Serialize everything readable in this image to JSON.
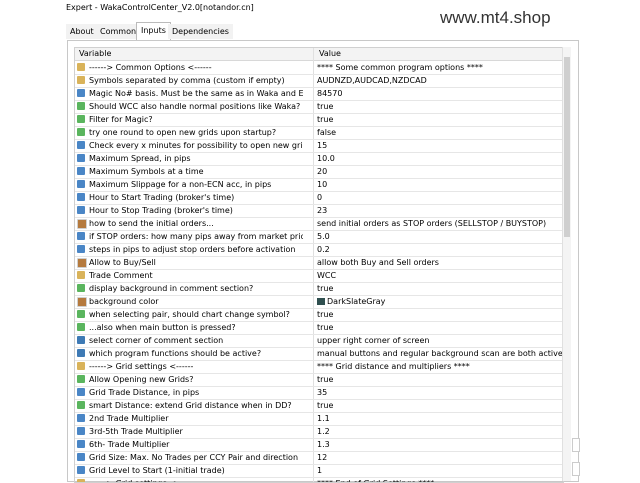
{
  "window": {
    "title": "Expert - WakaControlCenter_V2.0[notandor.cn]"
  },
  "watermark": "www.mt4.shop",
  "tabs": [
    {
      "label": "About"
    },
    {
      "label": "Common"
    },
    {
      "label": "Inputs"
    },
    {
      "label": "Dependencies"
    }
  ],
  "columns": {
    "variable": "Variable",
    "value": "Value"
  },
  "rows": [
    {
      "icon": "ab",
      "name": "------> Common Options <------",
      "value": "****      Some common program options         ****"
    },
    {
      "icon": "ab",
      "name": "Symbols separated by comma (custom if empty)",
      "value": "AUDNZD,AUDCAD,NZDCAD"
    },
    {
      "icon": "num",
      "name": "Magic No# basis. Must be the same as in Waka and End on...",
      "value": "84570"
    },
    {
      "icon": "line",
      "name": "Should WCC also handle normal positions like Waka?",
      "value": "true"
    },
    {
      "icon": "line",
      "name": "Filter for Magic?",
      "value": "true"
    },
    {
      "icon": "line",
      "name": "try one round to open new grids upon startup?",
      "value": "false"
    },
    {
      "icon": "num",
      "name": "Check every x minutes for possibility to open new grids",
      "value": "15"
    },
    {
      "icon": "num",
      "name": "Maximum Spread, in pips",
      "value": "10.0"
    },
    {
      "icon": "num",
      "name": "Maximum Symbols at a time",
      "value": "20"
    },
    {
      "icon": "num",
      "name": "Maximum Slippage for a non-ECN acc, in pips",
      "value": "10"
    },
    {
      "icon": "num",
      "name": "Hour to Start Trading (broker's time)",
      "value": "0"
    },
    {
      "icon": "num",
      "name": "Hour to Stop Trading (broker's time)",
      "value": "23"
    },
    {
      "icon": "grid",
      "name": "how to send the initial orders...",
      "value": "send initial orders as STOP orders (SELLSTOP / BUYSTOP)"
    },
    {
      "icon": "num",
      "name": "if STOP orders: how many pips away from market price?",
      "value": "5.0"
    },
    {
      "icon": "num",
      "name": "steps in pips to adjust stop orders before activation",
      "value": "0.2"
    },
    {
      "icon": "grid",
      "name": "Allow to Buy/Sell",
      "value": "allow both Buy and Sell orders"
    },
    {
      "icon": "ab",
      "name": "Trade Comment",
      "value": "WCC"
    },
    {
      "icon": "line",
      "name": "display background in comment section?",
      "value": "true"
    },
    {
      "icon": "grid",
      "name": "background color",
      "value": "DarkSlateGray",
      "swatch": "#2f4f4f"
    },
    {
      "icon": "line",
      "name": "when selecting pair, should chart change symbol?",
      "value": "true"
    },
    {
      "icon": "line",
      "name": "...also when main button is pressed?",
      "value": "true"
    },
    {
      "icon": "cs",
      "name": "select corner of comment section",
      "value": "upper right corner of screen"
    },
    {
      "icon": "cs",
      "name": "which program functions should be active?",
      "value": "manual buttons and regular background scan are both active"
    },
    {
      "icon": "ab",
      "name": "------> Grid settings <------",
      "value": "****           Grid distance and multipliers        ****"
    },
    {
      "icon": "line",
      "name": "Allow Opening new Grids?",
      "value": "true"
    },
    {
      "icon": "num",
      "name": "Grid Trade Distance, in pips",
      "value": "35"
    },
    {
      "icon": "line",
      "name": "smart Distance: extend Grid distance when in DD?",
      "value": "true"
    },
    {
      "icon": "num",
      "name": "2nd Trade Multiplier",
      "value": "1.1"
    },
    {
      "icon": "num",
      "name": "3rd-5th Trade Multiplier",
      "value": "1.2"
    },
    {
      "icon": "num",
      "name": "6th- Trade Multiplier",
      "value": "1.3"
    },
    {
      "icon": "num",
      "name": "Grid Size: Max. No Trades per CCY Pair and direction",
      "value": "12"
    },
    {
      "icon": "num",
      "name": "Grid Level to Start (1-initial trade)",
      "value": "1"
    },
    {
      "icon": "ab",
      "name": "------> Grid settings <------",
      "value": "****      End of Grid Settings      ****"
    }
  ]
}
